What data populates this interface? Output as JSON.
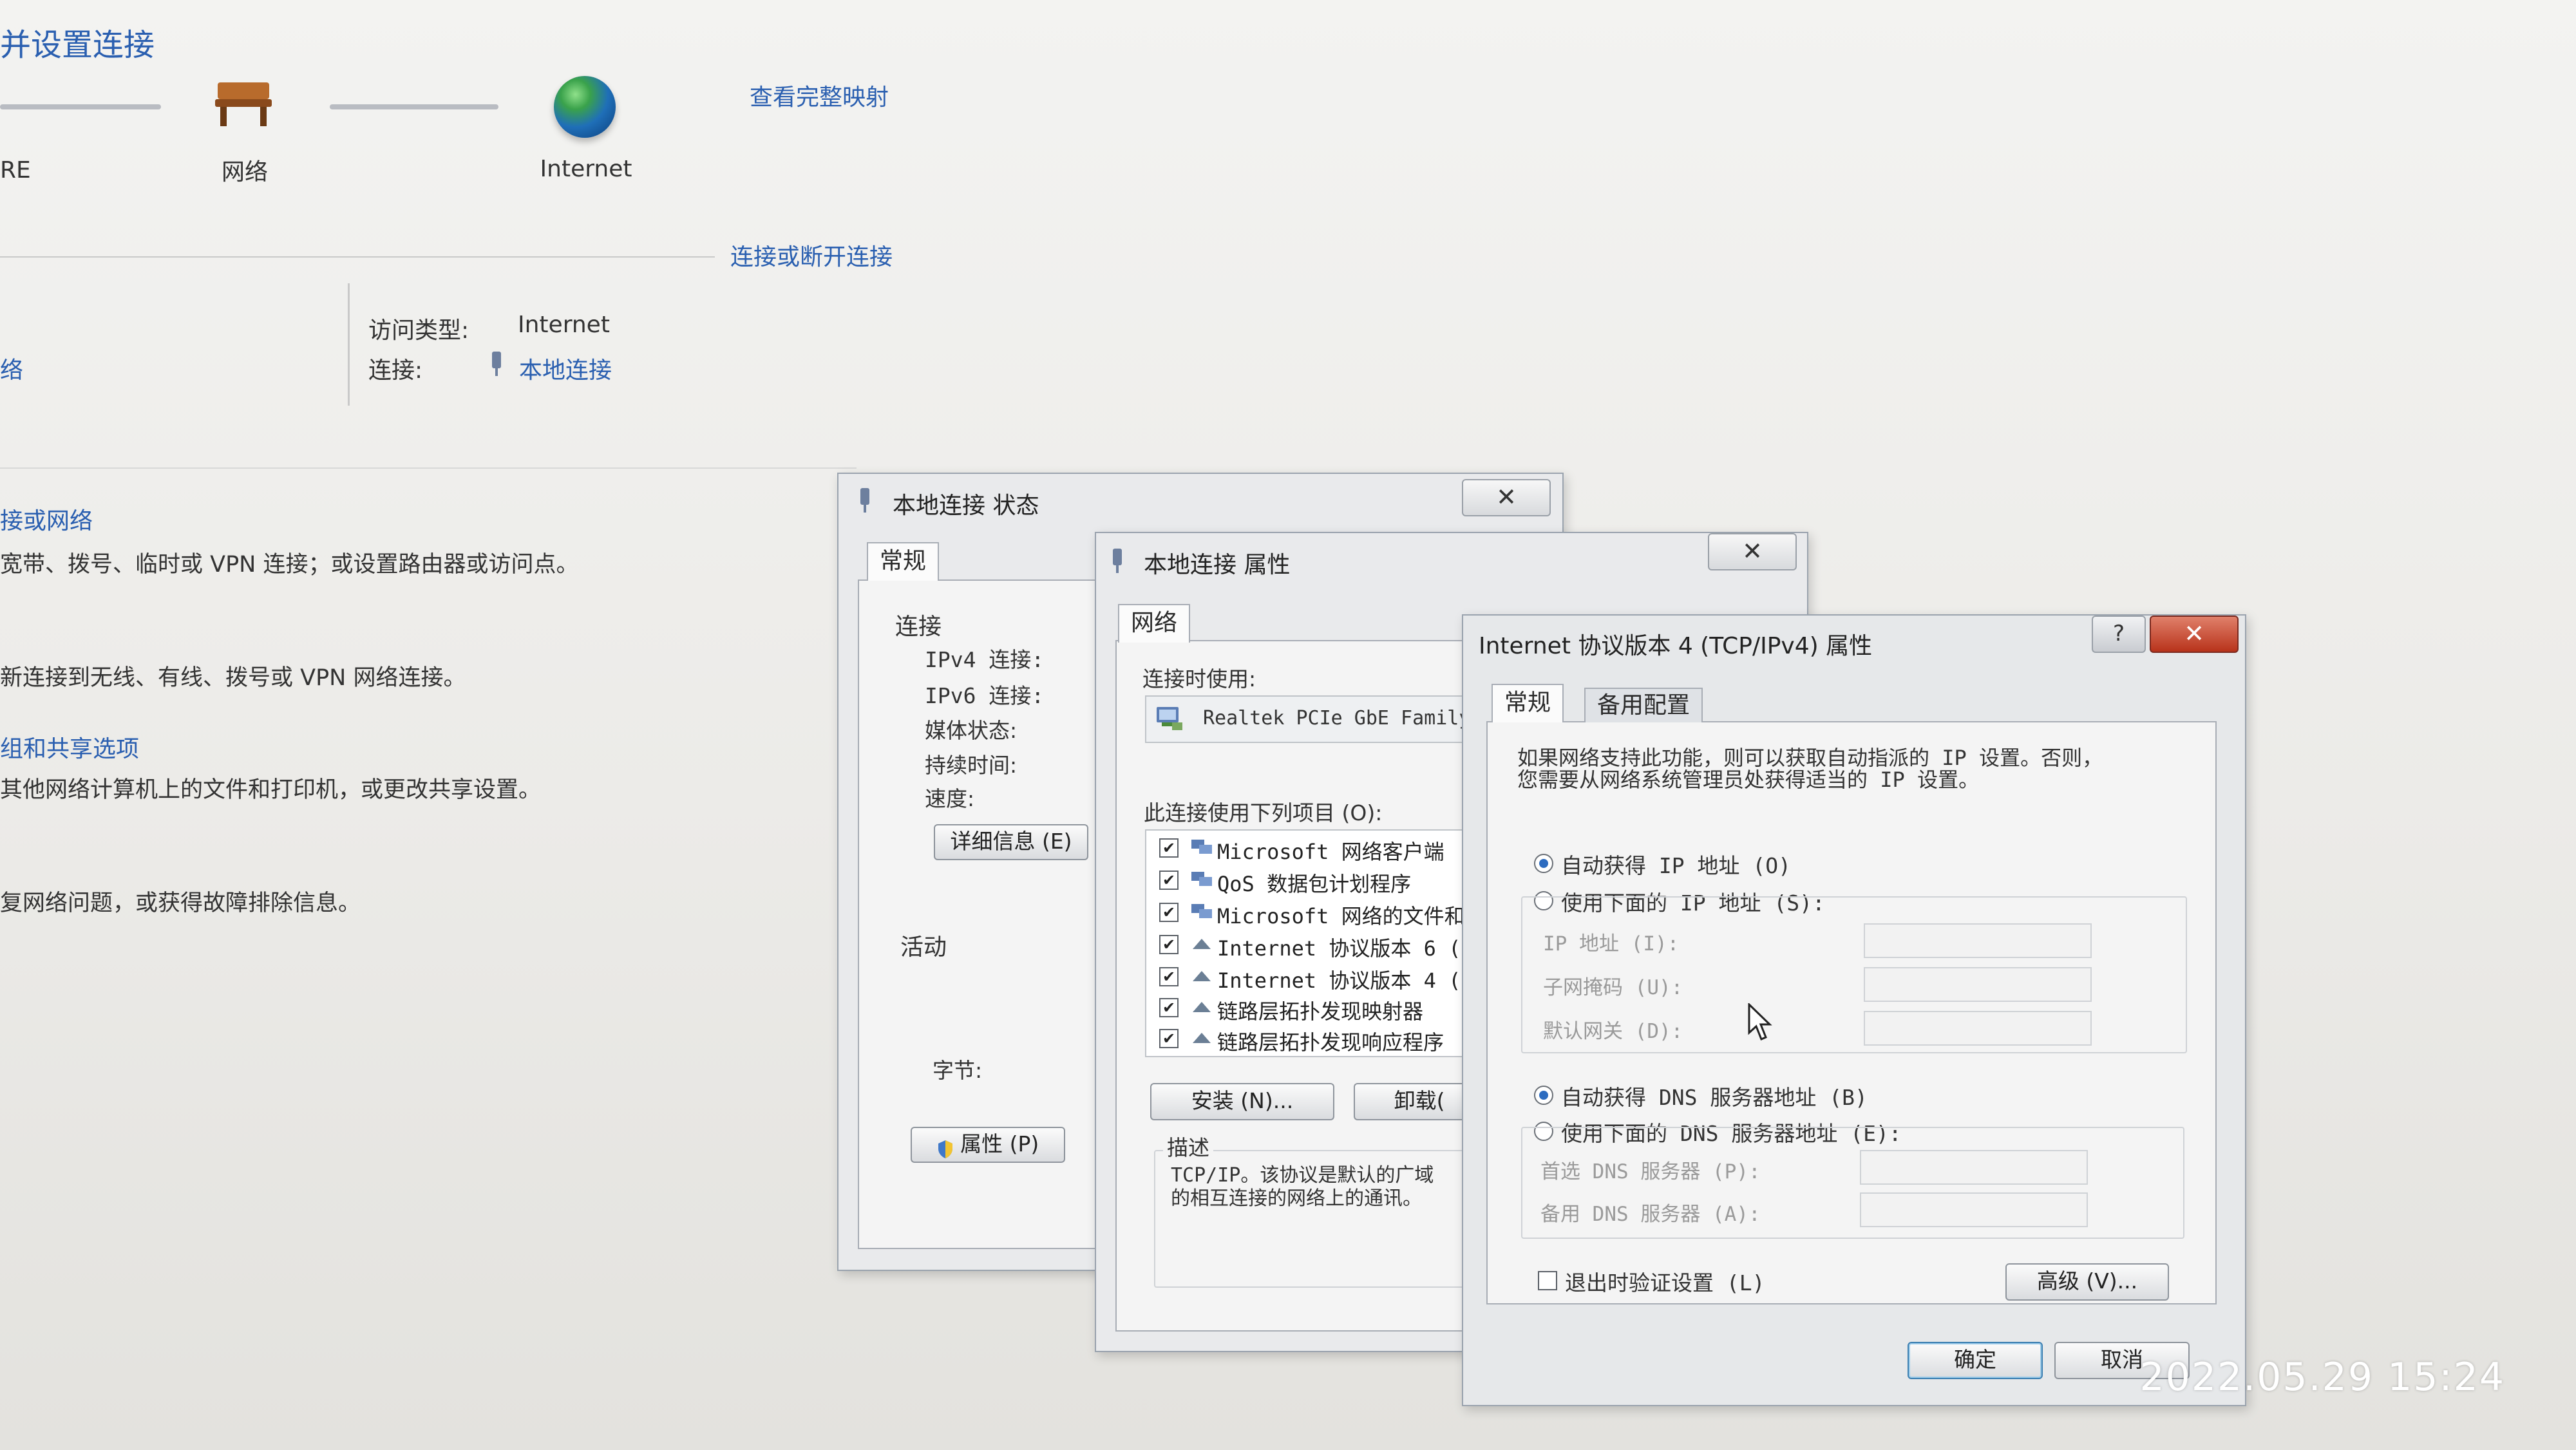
{
  "background": {
    "title": "并设置连接",
    "view_full_map": "查看完整映射",
    "node_left_label": "RE",
    "node_network_label": "网络",
    "node_internet_label": "Internet",
    "connect_disconnect": "连接或断开连接",
    "access_type_label": "访问类型:",
    "access_type_value": "Internet",
    "connection_label": "连接:",
    "connection_value": "本地连接",
    "left_fragment": "络",
    "sections": [
      {
        "link": "接或网络",
        "desc": "宽带、拨号、临时或 VPN 连接；或设置路由器或访问点。"
      },
      {
        "link": "",
        "desc": "新连接到无线、有线、拨号或 VPN 网络连接。"
      },
      {
        "link": "组和共享选项",
        "desc": "其他网络计算机上的文件和打印机，或更改共享设置。"
      },
      {
        "link": "",
        "desc": "复网络问题，或获得故障排除信息。"
      }
    ]
  },
  "status_dialog": {
    "title": "本地连接 状态",
    "tab": "常规",
    "connection_heading": "连接",
    "fields": [
      "IPv4 连接:",
      "IPv6 连接:",
      "媒体状态:",
      "持续时间:",
      "速度:"
    ],
    "details_button": "详细信息 (E)",
    "activity_heading": "活动",
    "bytes_label": "字节:",
    "properties_button": "属性 (P)"
  },
  "properties_dialog": {
    "title": "本地连接 属性",
    "tab": "网络",
    "connect_using_label": "连接时使用:",
    "adapter": "Realtek PCIe GbE Family",
    "items_label": "此连接使用下列项目 (O):",
    "items": [
      {
        "label": "Microsoft 网络客户端",
        "checked": "✔"
      },
      {
        "label": "QoS 数据包计划程序",
        "checked": "✔"
      },
      {
        "label": "Microsoft 网络的文件和",
        "checked": "✔"
      },
      {
        "label": "Internet 协议版本 6 (",
        "checked": "✔"
      },
      {
        "label": "Internet 协议版本 4 (",
        "checked": "✔"
      },
      {
        "label": "链路层拓扑发现映射器",
        "checked": "✔"
      },
      {
        "label": "链路层拓扑发现响应程序",
        "checked": "✔"
      }
    ],
    "install_button": "安装 (N)...",
    "uninstall_button": "卸载(",
    "description_label": "描述",
    "description_line1": "TCP/IP。该协议是默认的广域",
    "description_line2": "的相互连接的网络上的通讯。"
  },
  "ipv4_dialog": {
    "title": "Internet 协议版本 4 (TCP/IPv4) 属性",
    "help": "?",
    "close": "✕",
    "tab_general": "常规",
    "tab_alternate": "备用配置",
    "intro_line1": "如果网络支持此功能，则可以获取自动指派的 IP 设置。否则，",
    "intro_line2": "您需要从网络系统管理员处获得适当的 IP 设置。",
    "auto_ip": "自动获得 IP 地址 (O)",
    "manual_ip": "使用下面的 IP 地址 (S):",
    "ip_address": "IP 地址 (I):",
    "subnet_mask": "子网掩码 (U):",
    "gateway": "默认网关 (D):",
    "auto_dns": "自动获得 DNS 服务器地址 (B)",
    "manual_dns": "使用下面的 DNS 服务器地址 (E):",
    "preferred_dns": "首选 DNS 服务器 (P):",
    "alternate_dns": "备用 DNS 服务器 (A):",
    "validate_on_exit": "退出时验证设置 (L)",
    "advanced_button": "高级 (V)...",
    "ok_button": "确定",
    "cancel_button": "取消"
  },
  "close_glyph": "✕",
  "timestamp": "2022.05.29  15:24"
}
